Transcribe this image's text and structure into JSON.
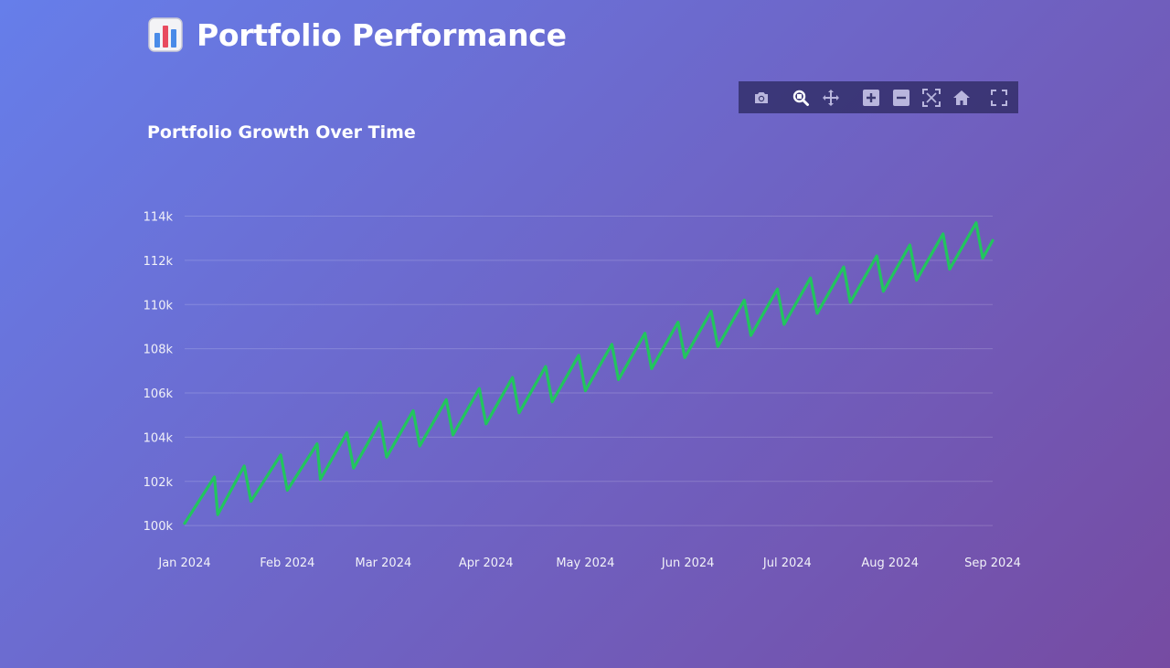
{
  "app": {
    "title": "Portfolio Performance",
    "icon": "bar-chart-icon"
  },
  "modebar": {
    "buttons": [
      {
        "name": "camera-icon"
      },
      {
        "name": "zoom-icon",
        "active": true
      },
      {
        "name": "pan-icon"
      },
      {
        "name": "zoom-in-icon"
      },
      {
        "name": "zoom-out-icon"
      },
      {
        "name": "autoscale-icon"
      },
      {
        "name": "home-icon"
      },
      {
        "name": "fullscreen-icon"
      }
    ]
  },
  "colors": {
    "line": "#22c55e",
    "background_start": "#667eea",
    "background_end": "#764ba2",
    "modebar": "#28265a"
  },
  "chart_data": {
    "type": "line",
    "title": "Portfolio Growth Over Time",
    "xlabel": "",
    "ylabel": "",
    "grid": true,
    "legend": "none",
    "x_tick_labels": [
      "Jan 2024",
      "Feb 2024",
      "Mar 2024",
      "Apr 2024",
      "May 2024",
      "Jun 2024",
      "Jul 2024",
      "Aug 2024",
      "Sep 2024"
    ],
    "y_tick_labels": [
      "100k",
      "102k",
      "104k",
      "106k",
      "108k",
      "110k",
      "112k",
      "114k"
    ],
    "y_ticks": [
      100000,
      102000,
      104000,
      106000,
      108000,
      110000,
      112000,
      114000
    ],
    "xlim": [
      "2024-01-01",
      "2024-09-01"
    ],
    "ylim": [
      99800,
      114600
    ],
    "series": [
      {
        "values": [
          [
            "2024-01-01",
            100100
          ],
          [
            "2024-01-10",
            102200
          ],
          [
            "2024-01-11",
            100500
          ],
          [
            "2024-01-19",
            102700
          ],
          [
            "2024-01-21",
            101100
          ],
          [
            "2024-01-30",
            103200
          ],
          [
            "2024-02-01",
            101600
          ],
          [
            "2024-02-10",
            103700
          ],
          [
            "2024-02-11",
            102100
          ],
          [
            "2024-02-19",
            104200
          ],
          [
            "2024-02-21",
            102600
          ],
          [
            "2024-02-29",
            104700
          ],
          [
            "2024-03-02",
            103100
          ],
          [
            "2024-03-10",
            105200
          ],
          [
            "2024-03-12",
            103600
          ],
          [
            "2024-03-20",
            105700
          ],
          [
            "2024-03-22",
            104100
          ],
          [
            "2024-03-30",
            106200
          ],
          [
            "2024-04-01",
            104600
          ],
          [
            "2024-04-09",
            106700
          ],
          [
            "2024-04-11",
            105100
          ],
          [
            "2024-04-19",
            107200
          ],
          [
            "2024-04-21",
            105600
          ],
          [
            "2024-04-29",
            107700
          ],
          [
            "2024-05-01",
            106100
          ],
          [
            "2024-05-09",
            108200
          ],
          [
            "2024-05-11",
            106600
          ],
          [
            "2024-05-19",
            108700
          ],
          [
            "2024-05-21",
            107100
          ],
          [
            "2024-05-29",
            109200
          ],
          [
            "2024-05-31",
            107600
          ],
          [
            "2024-06-08",
            109700
          ],
          [
            "2024-06-10",
            108100
          ],
          [
            "2024-06-18",
            110200
          ],
          [
            "2024-06-20",
            108600
          ],
          [
            "2024-06-28",
            110700
          ],
          [
            "2024-06-30",
            109100
          ],
          [
            "2024-07-08",
            111200
          ],
          [
            "2024-07-10",
            109600
          ],
          [
            "2024-07-18",
            111700
          ],
          [
            "2024-07-20",
            110100
          ],
          [
            "2024-07-28",
            112200
          ],
          [
            "2024-07-30",
            110600
          ],
          [
            "2024-08-07",
            112700
          ],
          [
            "2024-08-09",
            111100
          ],
          [
            "2024-08-17",
            113200
          ],
          [
            "2024-08-19",
            111600
          ],
          [
            "2024-08-27",
            113700
          ],
          [
            "2024-08-29",
            112100
          ],
          [
            "2024-09-01",
            112900
          ]
        ]
      }
    ]
  }
}
